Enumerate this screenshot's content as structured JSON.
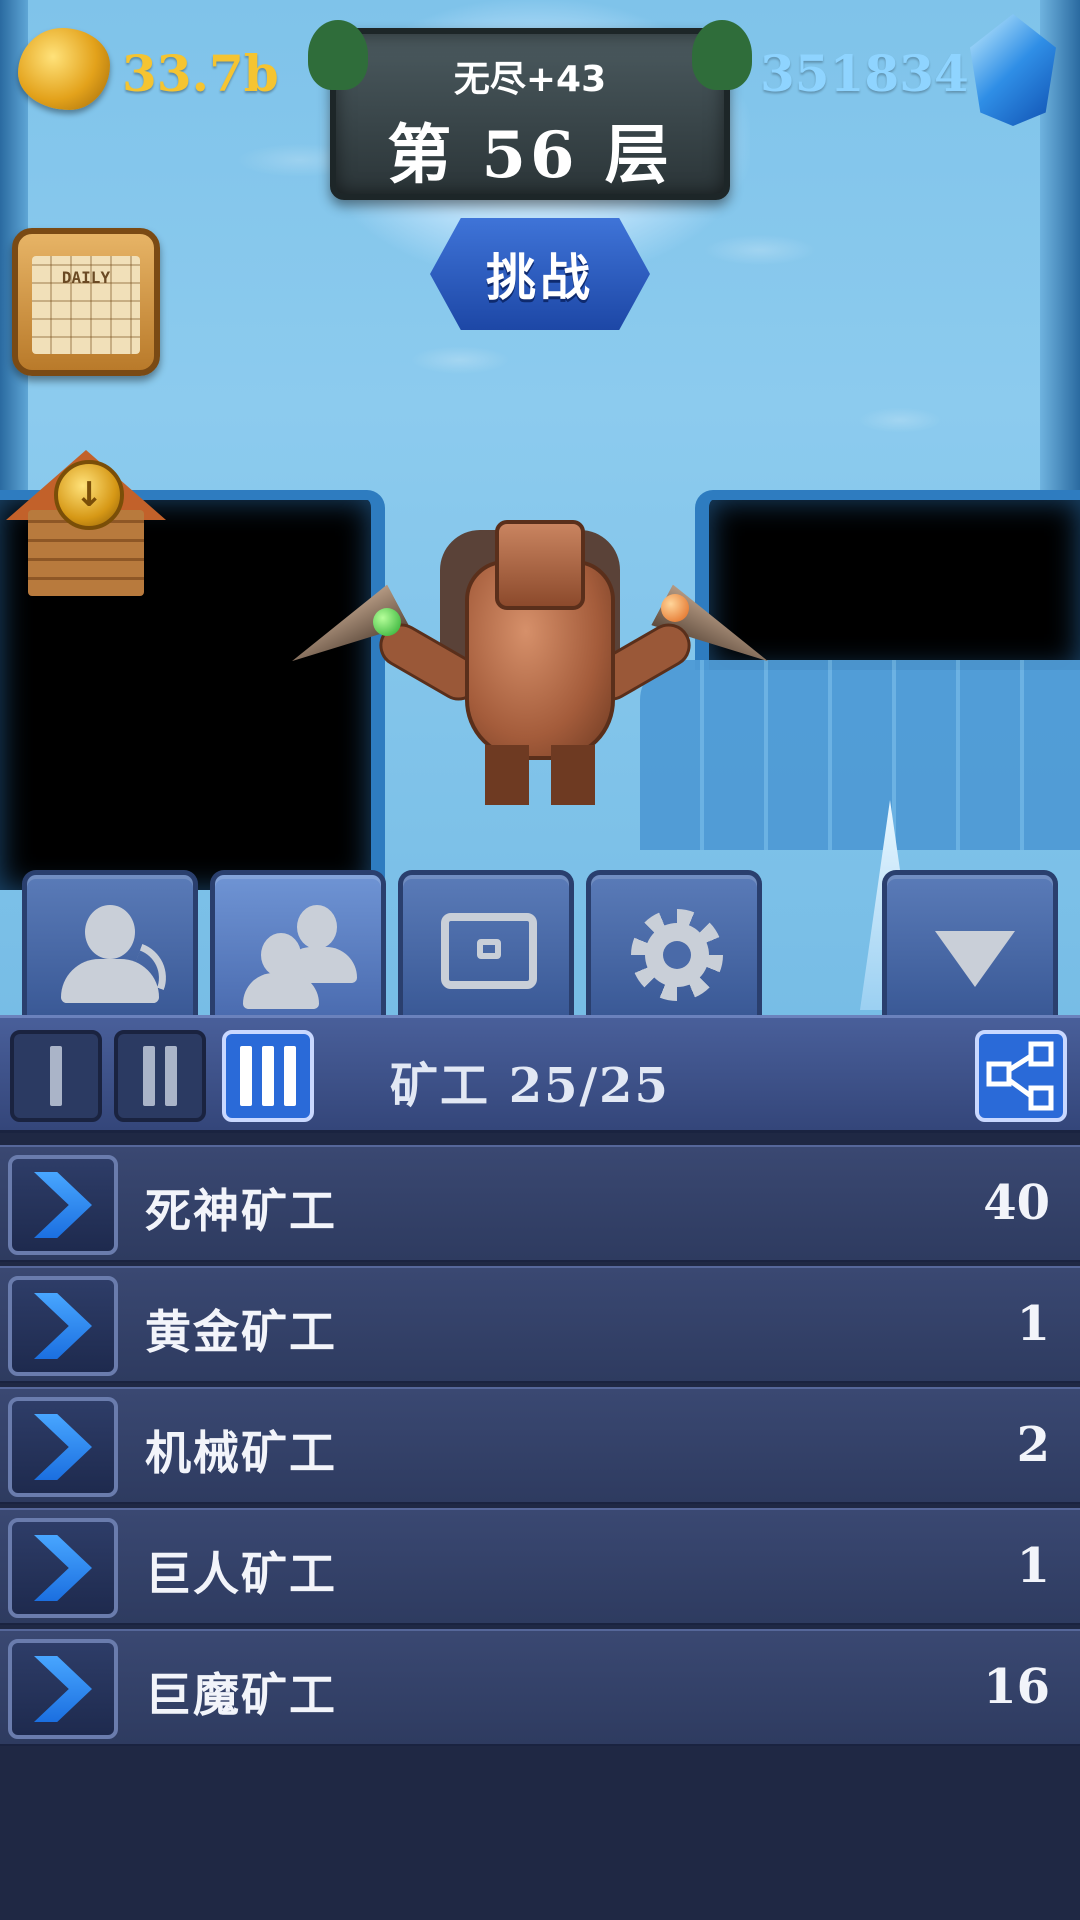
{
  "hud": {
    "gold_amount": "33.7b",
    "gem_amount": "351834",
    "daily_label": "DAILY"
  },
  "level": {
    "endless": "无尽+43",
    "floor": "第 56 层",
    "challenge_label": "挑战"
  },
  "tabs": [
    {
      "icon": "single-miner-icon",
      "active": false
    },
    {
      "icon": "miner-group-icon",
      "active": true
    },
    {
      "icon": "chest-icon",
      "active": false
    },
    {
      "icon": "gear-icon",
      "active": false
    },
    {
      "icon": "down-arrow-icon",
      "active": false
    }
  ],
  "panel": {
    "title": "矿工  25/25",
    "tiers": [
      "I",
      "II",
      "III"
    ],
    "active_tier": "III"
  },
  "miners": [
    {
      "name": "死神矿工",
      "count": "40"
    },
    {
      "name": "黄金矿工",
      "count": "1"
    },
    {
      "name": "机械矿工",
      "count": "2"
    },
    {
      "name": "巨人矿工",
      "count": "1"
    },
    {
      "name": "巨魔矿工",
      "count": "16"
    }
  ],
  "colors": {
    "gold_text": "#f5c431",
    "gem_text": "#8fd4ff",
    "active_blue": "#2a6ad8",
    "panel_bg": "#1f2844"
  }
}
